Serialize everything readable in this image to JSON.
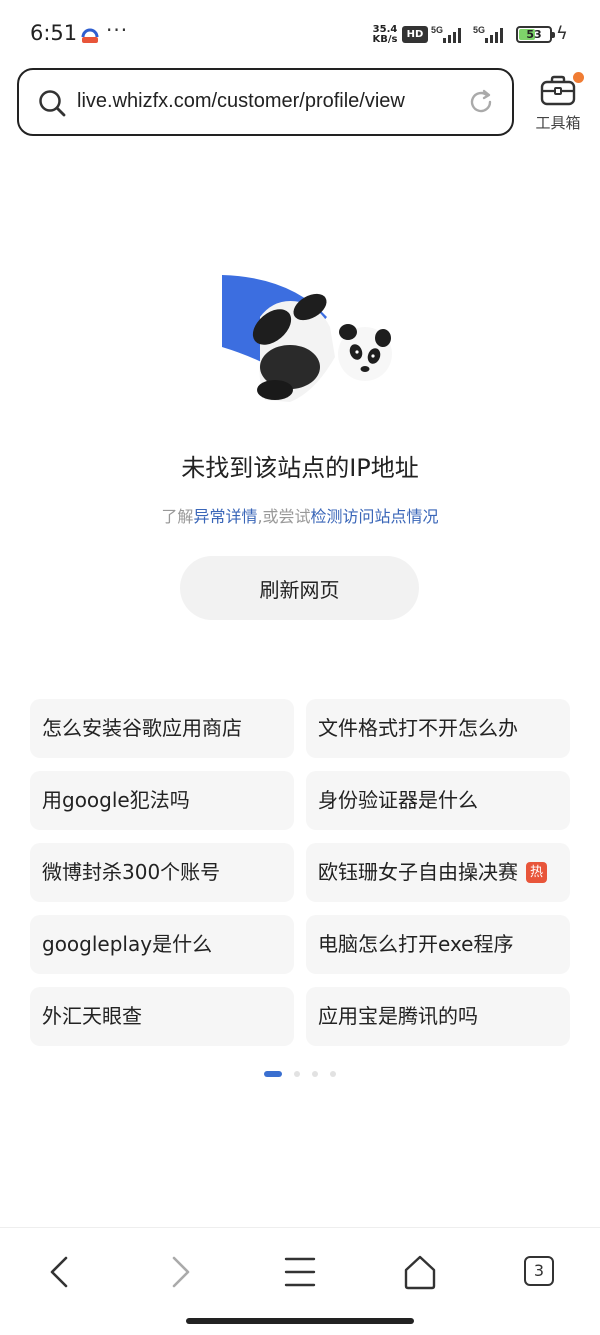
{
  "status_bar": {
    "time": "6:51",
    "more": "···",
    "net_speed_value": "35.4",
    "net_speed_unit": "KB/s",
    "hd_label": "HD",
    "sim1_label": "5G",
    "sim2_label": "5G",
    "battery_level": "53"
  },
  "url_bar": {
    "url": "live.whizfx.com/customer/profile/view",
    "toolbox_label": "工具箱"
  },
  "error": {
    "title": "未找到该站点的IP地址",
    "sub_prefix": "了解",
    "sub_link1": "异常详情",
    "sub_middle": ",或尝试",
    "sub_link2": "检测访问站点情况",
    "refresh_button": "刷新网页"
  },
  "suggestions": [
    {
      "text": "怎么安装谷歌应用商店",
      "hot": false
    },
    {
      "text": "文件格式打不开怎么办",
      "hot": false
    },
    {
      "text": "用google犯法吗",
      "hot": false
    },
    {
      "text": "身份验证器是什么",
      "hot": false
    },
    {
      "text": "微博封杀300个账号",
      "hot": false
    },
    {
      "text": "欧钰珊女子自由操决赛",
      "hot": true,
      "hot_label": "热"
    },
    {
      "text": "googleplay是什么",
      "hot": false
    },
    {
      "text": "电脑怎么打开exe程序",
      "hot": false
    },
    {
      "text": "外汇天眼查",
      "hot": false
    },
    {
      "text": "应用宝是腾讯的吗",
      "hot": false
    }
  ],
  "pager": {
    "pages": 4,
    "active_page": 1
  },
  "bottom_nav": {
    "tab_count": "3",
    "icons": [
      "back-icon",
      "forward-icon",
      "menu-icon",
      "home-icon",
      "tabs-icon"
    ]
  },
  "colors": {
    "accent": "#3a6fd0",
    "link": "#3a66b8",
    "hot_badge": "#e8553a",
    "notification_dot": "#f07c33",
    "battery_fill": "#7ed36a"
  }
}
